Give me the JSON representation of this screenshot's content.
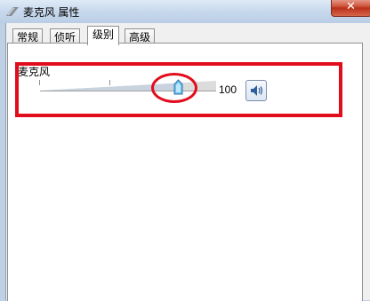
{
  "window": {
    "title": "麦克风 属性",
    "close_label": "✕"
  },
  "tabs": [
    {
      "label": "常规"
    },
    {
      "label": "侦听"
    },
    {
      "label": "级别",
      "active": true
    },
    {
      "label": "高级"
    }
  ],
  "levels": {
    "group_label": "麦克风",
    "value": "100",
    "slider_level_percent": 100
  },
  "icons": {
    "window": "window-icon",
    "speaker": "speaker-icon"
  },
  "colors": {
    "annotation": "#e20d1c"
  }
}
